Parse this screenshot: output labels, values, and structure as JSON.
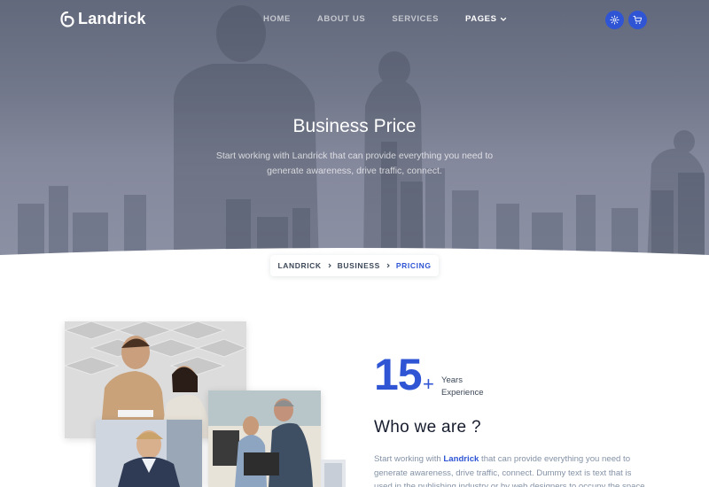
{
  "brand": {
    "name": "Landrick"
  },
  "nav": {
    "items": [
      {
        "label": "HOME"
      },
      {
        "label": "ABOUT US"
      },
      {
        "label": "SERVICES"
      },
      {
        "label": "PAGES"
      }
    ],
    "icons": [
      "settings-icon",
      "cart-icon"
    ]
  },
  "hero": {
    "title": "Business Price",
    "subtitle": "Start working with Landrick that can provide everything you need to generate awareness, drive traffic, connect."
  },
  "breadcrumb": {
    "items": [
      "LANDRICK",
      "BUSINESS",
      "PRICING"
    ]
  },
  "stats": {
    "number": "15",
    "plus": "+",
    "label_line1": "Years",
    "label_line2": "Experience"
  },
  "about": {
    "heading": "Who we are ?",
    "text_prefix": "Start working with ",
    "text_brand": "Landrick",
    "text_suffix": " that can provide everything you need to generate awareness, drive traffic, connect. Dummy text is text that is used in the publishing industry or by web designers to occupy the space"
  },
  "colors": {
    "primary": "#2f55d4",
    "heading": "#161c2d",
    "muted": "#8492a6"
  }
}
